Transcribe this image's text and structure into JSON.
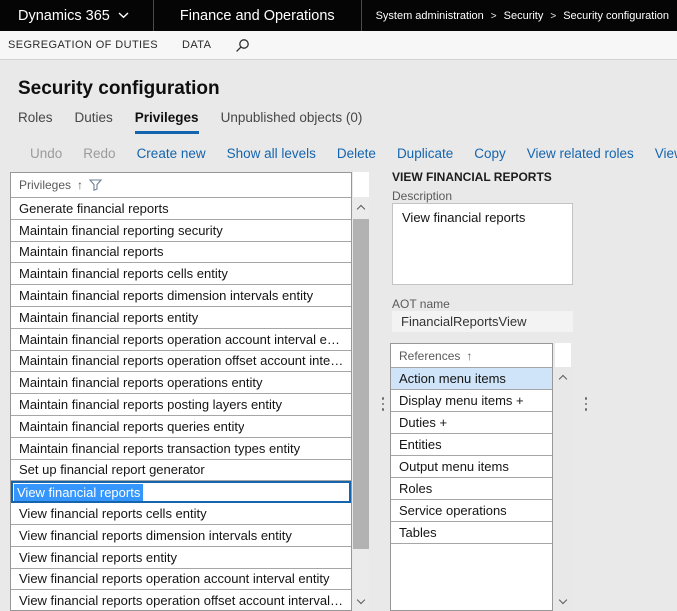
{
  "colors": {
    "accent": "#1565ae",
    "selection_bg": "#3596fd",
    "reference_selected_bg": "#cfe4f8"
  },
  "icons": {
    "dropdown": "chevron-down",
    "search": "magnifier",
    "sort_ascending": "↑",
    "filter": "funnel",
    "scroll_up": "chevron-up",
    "scroll_down": "chevron-down"
  },
  "top_bar": {
    "product": "Dynamics 365",
    "app": "Finance and Operations",
    "breadcrumb": [
      "System administration",
      "Security",
      "Security configuration"
    ]
  },
  "action_bar": {
    "items": [
      "SEGREGATION OF DUTIES",
      "DATA"
    ]
  },
  "page": {
    "title": "Security configuration",
    "tabs": [
      "Roles",
      "Duties",
      "Privileges",
      "Unpublished objects (0)"
    ],
    "active_tab_index": 2,
    "toolbar_disabled": [
      "Undo",
      "Redo"
    ],
    "toolbar_actions": [
      "Create new",
      "Show all levels",
      "Delete",
      "Duplicate",
      "Copy",
      "View related roles",
      "View permissions"
    ]
  },
  "privileges_grid": {
    "header": "Privileges",
    "sort": "ascending",
    "selected_index": 13,
    "rows": [
      "Generate financial reports",
      "Maintain financial reporting security",
      "Maintain financial reports",
      "Maintain financial reports cells entity",
      "Maintain financial reports dimension intervals entity",
      "Maintain financial reports entity",
      "Maintain financial reports operation account interval entity",
      "Maintain financial reports operation offset account interval entity",
      "Maintain financial reports operations entity",
      "Maintain financial reports posting layers entity",
      "Maintain financial reports queries entity",
      "Maintain financial reports transaction types entity",
      "Set up financial report generator",
      "View financial reports",
      "View financial reports cells entity",
      "View financial reports dimension intervals entity",
      "View financial reports entity",
      "View financial reports operation account interval entity",
      "View financial reports operation offset account interval entity"
    ]
  },
  "details": {
    "title": "VIEW FINANCIAL REPORTS",
    "description_label": "Description",
    "description_value": "View financial reports",
    "aot_label": "AOT name",
    "aot_value": "FinancialReportsView"
  },
  "references_grid": {
    "header": "References",
    "sort": "ascending",
    "selected_index": 0,
    "rows": [
      "Action menu items",
      "Display menu items +",
      "Duties +",
      "Entities",
      "Output menu items",
      "Roles",
      "Service operations",
      "Tables"
    ]
  }
}
